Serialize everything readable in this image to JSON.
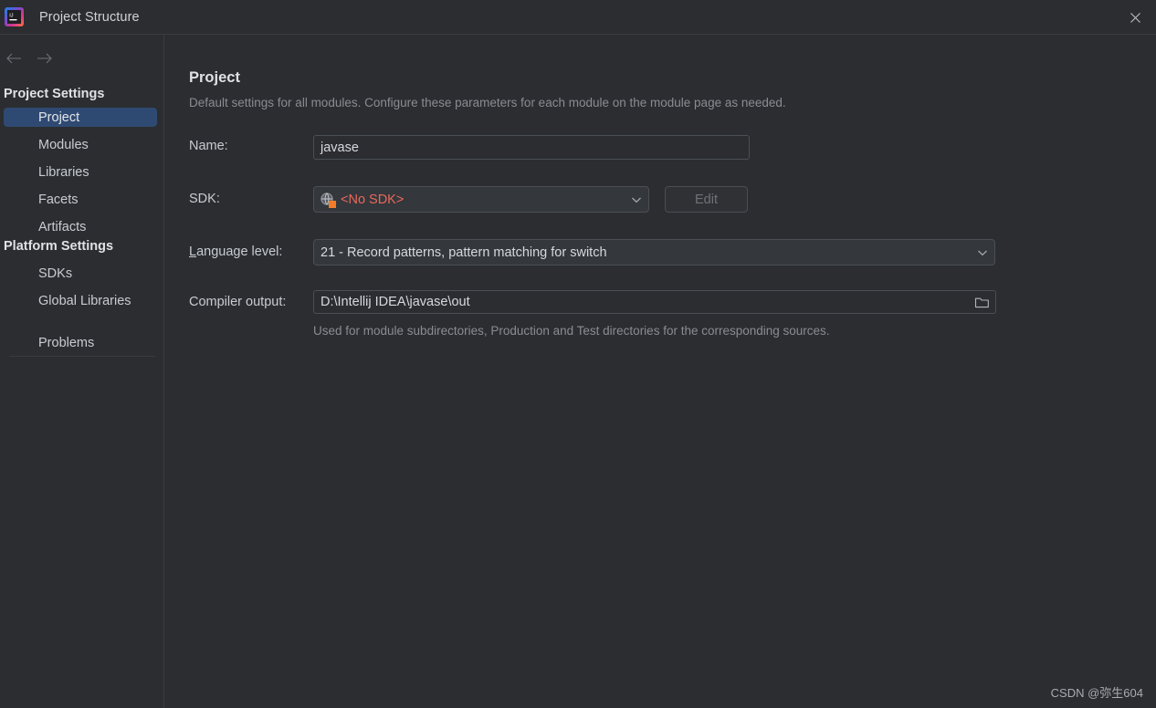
{
  "window": {
    "title": "Project Structure",
    "logo_icon": "intellij-idea-logo-icon",
    "logo_text": "IJ",
    "close_icon": "close-icon",
    "bg_color": "#2b2d30",
    "border_color": "#393b40"
  },
  "sidebar": {
    "back_icon": "arrow-left-icon",
    "forward_icon": "arrow-right-icon",
    "groups": [
      {
        "title": "Project Settings",
        "items": [
          {
            "label": "Project",
            "selected": true
          },
          {
            "label": "Modules",
            "selected": false
          },
          {
            "label": "Libraries",
            "selected": false
          },
          {
            "label": "Facets",
            "selected": false
          },
          {
            "label": "Artifacts",
            "selected": false
          }
        ]
      },
      {
        "title": "Platform Settings",
        "items": [
          {
            "label": "SDKs",
            "selected": false
          },
          {
            "label": "Global Libraries",
            "selected": false
          }
        ]
      }
    ],
    "footer_items": [
      {
        "label": "Problems",
        "selected": false
      }
    ],
    "selected_bg": "#2f4a72"
  },
  "main": {
    "title": "Project",
    "description": "Default settings for all modules. Configure these parameters for each module on the module page as needed.",
    "fields": {
      "name": {
        "label": "Name:",
        "value": "javase",
        "placeholder": ""
      },
      "sdk": {
        "label": "SDK:",
        "value": "<No SDK>",
        "value_color": "#e8685c",
        "icon": "sdk-globe-warning-icon",
        "dropdown_icon": "chevron-down-icon",
        "edit_button": {
          "label": "Edit",
          "enabled": false
        }
      },
      "language_level": {
        "label": "Language level:",
        "mnemonic": "L",
        "label_rest": "anguage level:",
        "value": "21 - Record patterns, pattern matching for switch",
        "dropdown_icon": "chevron-down-icon"
      },
      "compiler_output": {
        "label": "Compiler output:",
        "value": "D:\\Intellij IDEA\\javase\\out",
        "placeholder": "",
        "browse_icon": "folder-icon",
        "hint": "Used for module subdirectories, Production and Test directories for the corresponding sources."
      }
    }
  },
  "watermark": {
    "text": "CSDN @弥生604"
  }
}
